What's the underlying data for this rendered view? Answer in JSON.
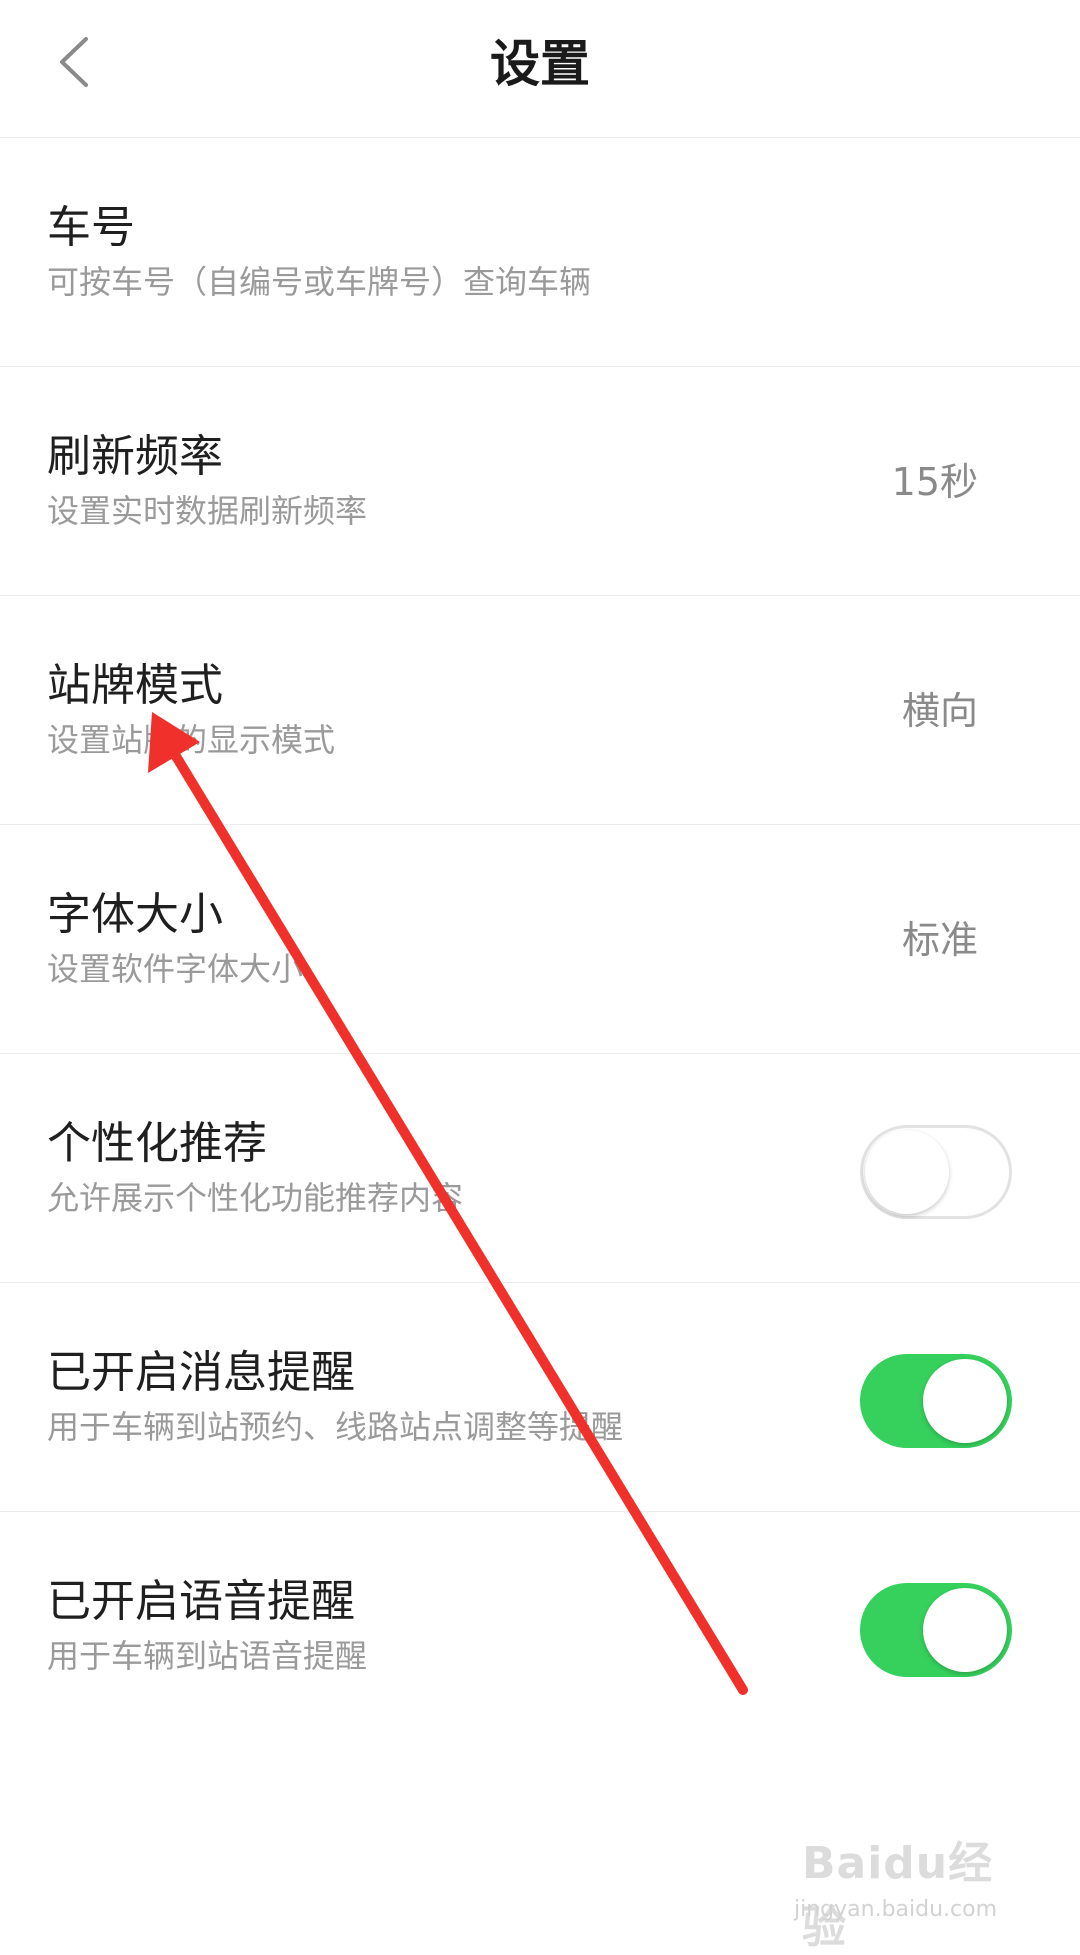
{
  "header": {
    "title": "设置",
    "back_icon": "chevron-left-icon"
  },
  "settings": [
    {
      "title": "车号",
      "subtitle": "可按车号（自编号或车牌号）查询车辆"
    },
    {
      "title": "刷新频率",
      "subtitle": "设置实时数据刷新频率",
      "value": "15秒"
    },
    {
      "title": "站牌模式",
      "subtitle": "设置站牌的显示模式",
      "value": "横向"
    },
    {
      "title": "字体大小",
      "subtitle": "设置软件字体大小",
      "value": "标准"
    },
    {
      "title": "个性化推荐",
      "subtitle": "允许展示个性化功能推荐内容",
      "toggle": "off"
    },
    {
      "title": "已开启消息提醒",
      "subtitle": "用于车辆到站预约、线路站点调整等提醒",
      "toggle": "on"
    },
    {
      "title": "已开启语音提醒",
      "subtitle": "用于车辆到站语音提醒",
      "toggle": "on"
    }
  ],
  "colors": {
    "toggle_on": "#35d15c",
    "toggle_off_border": "#e2e2e2",
    "annotation_arrow": "#f0302a"
  },
  "watermark": {
    "logo_text": "Baidu经验",
    "url": "jingyan.baidu.com"
  }
}
